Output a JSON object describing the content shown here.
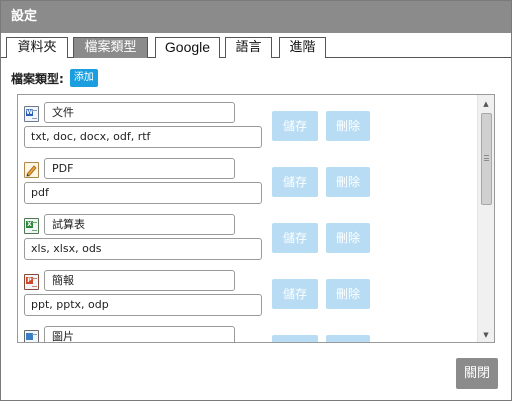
{
  "dialog": {
    "title": "設定"
  },
  "tabs": [
    {
      "label": "資料夾",
      "active": false
    },
    {
      "label": "檔案類型",
      "active": true
    },
    {
      "label": "Google",
      "active": false
    },
    {
      "label": "語言",
      "active": false
    },
    {
      "label": "進階",
      "active": false
    }
  ],
  "file_types": {
    "label": "檔案類型:",
    "add_label": "添加",
    "save_label": "儲存",
    "delete_label": "刪除",
    "items": [
      {
        "icon": "word-document-icon",
        "name": "文件",
        "extensions": "txt, doc, docx, odf, rtf"
      },
      {
        "icon": "pdf-document-icon",
        "name": "PDF",
        "extensions": "pdf"
      },
      {
        "icon": "excel-spreadsheet-icon",
        "name": "試算表",
        "extensions": "xls, xlsx, ods"
      },
      {
        "icon": "powerpoint-presentation-icon",
        "name": "簡報",
        "extensions": "ppt, pptx, odp"
      },
      {
        "icon": "image-file-icon",
        "name": "圖片",
        "extensions": ""
      }
    ]
  },
  "footer": {
    "close_label": "關閉"
  },
  "colors": {
    "titlebar": "#8b8b8b",
    "accent": "#1b9ee0",
    "disabled_button": "#b8dcf3"
  }
}
